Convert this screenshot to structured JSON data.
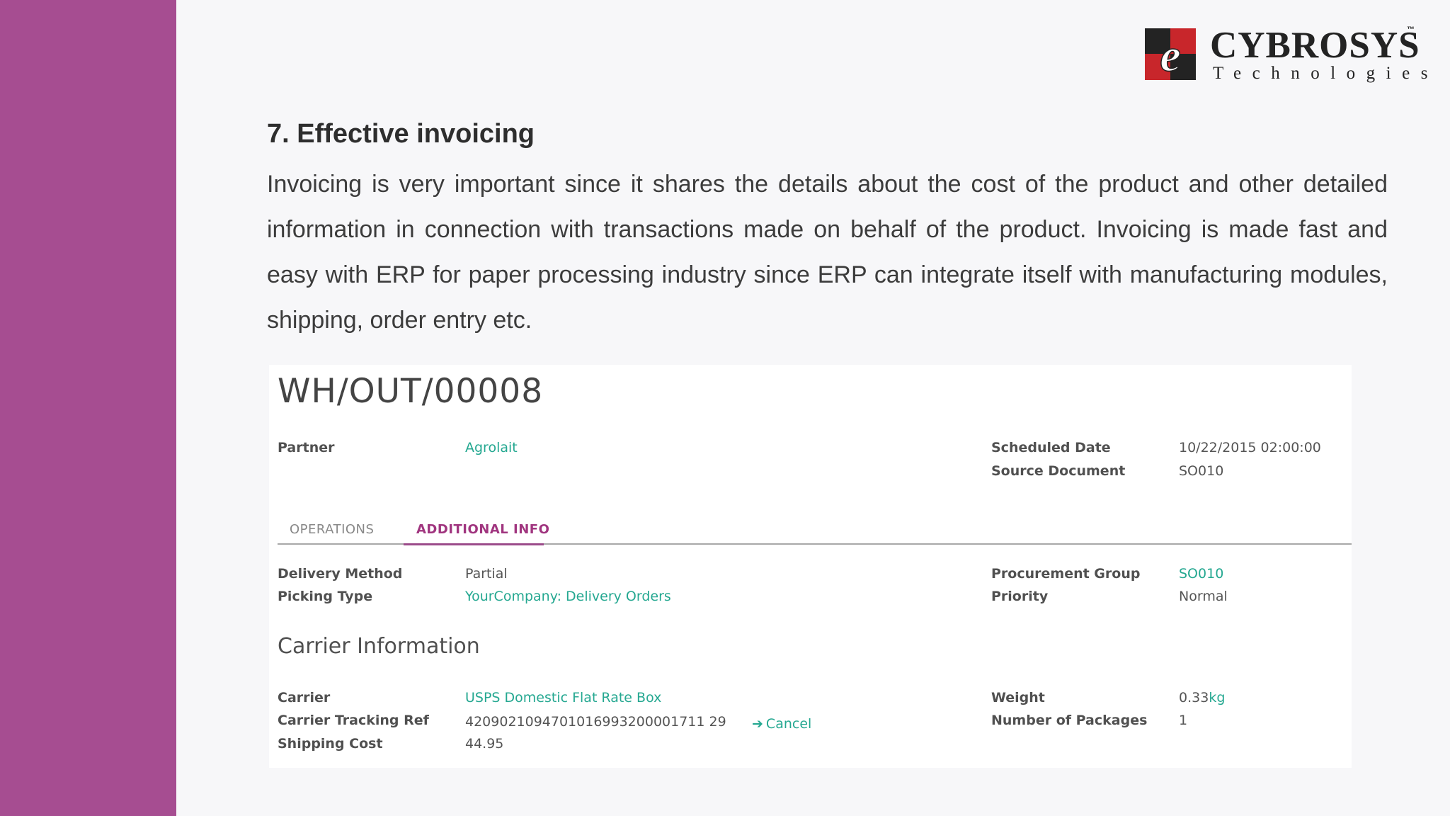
{
  "brand": {
    "name": "CYBROSYS",
    "tm": "™",
    "sub": "Technologies",
    "mark_letter": "e",
    "colors": {
      "red": "#c8262b",
      "black": "#232323"
    }
  },
  "slide": {
    "heading": "7. Effective invoicing",
    "body": "Invoicing is very important since it shares the details about the cost of the product and other detailed information in connection with transactions made on behalf of the product. Invoicing is made fast and easy with ERP for paper processing industry since ERP can integrate itself with manufacturing modules, shipping, order entry etc.",
    "accent": "#a64d91"
  },
  "form": {
    "title": "WH/OUT/00008",
    "partner_label": "Partner",
    "partner_value": "Agrolait",
    "scheduled_date_label": "Scheduled Date",
    "scheduled_date_value": "10/22/2015 02:00:00",
    "source_document_label": "Source Document",
    "source_document_value": "SO010",
    "tabs": {
      "operations": "OPERATIONS",
      "additional_info": "ADDITIONAL INFO"
    },
    "delivery_method_label": "Delivery Method",
    "delivery_method_value": "Partial",
    "picking_type_label": "Picking Type",
    "picking_type_value": "YourCompany: Delivery Orders",
    "procurement_group_label": "Procurement Group",
    "procurement_group_value": "SO010",
    "priority_label": "Priority",
    "priority_value": "Normal",
    "carrier_section": "Carrier Information",
    "carrier_label": "Carrier",
    "carrier_value": "USPS Domestic Flat Rate Box",
    "tracking_label": "Carrier Tracking Ref",
    "tracking_value": "4209021094701016993200001711 29",
    "cancel_label": "Cancel",
    "shipping_cost_label": "Shipping Cost",
    "shipping_cost_value": "44.95",
    "weight_label": "Weight",
    "weight_value": "0.33",
    "weight_unit": "kg",
    "packages_label": "Number of Packages",
    "packages_value": "1",
    "link_color": "#25a891"
  }
}
